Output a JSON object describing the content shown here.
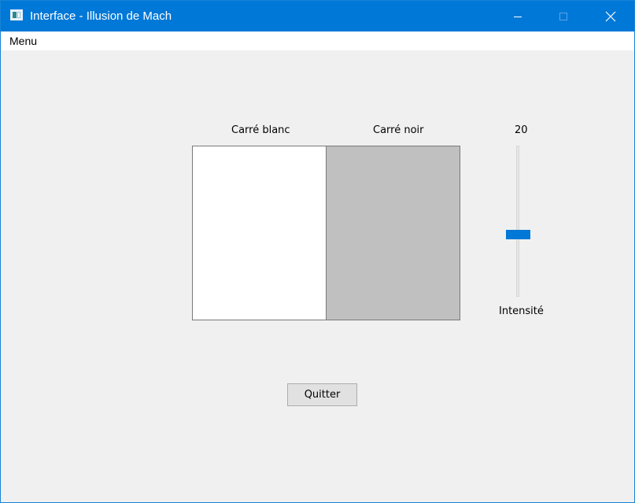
{
  "window": {
    "title": "Interface - Illusion de Mach",
    "icon": "app-window-icon",
    "controls": [
      "minimize-icon",
      "maximize-icon",
      "close-icon"
    ],
    "accent_color": "#0078d7"
  },
  "menubar": {
    "items": [
      {
        "label": "Menu"
      }
    ]
  },
  "squares": {
    "white_label": "Carré blanc",
    "black_label": "Carré noir",
    "white_color": "#ffffff",
    "black_color": "#c0c0c0"
  },
  "slider": {
    "value": "20",
    "label": "Intensité",
    "fraction": 0.59
  },
  "buttons": {
    "quit_label": "Quitter"
  }
}
